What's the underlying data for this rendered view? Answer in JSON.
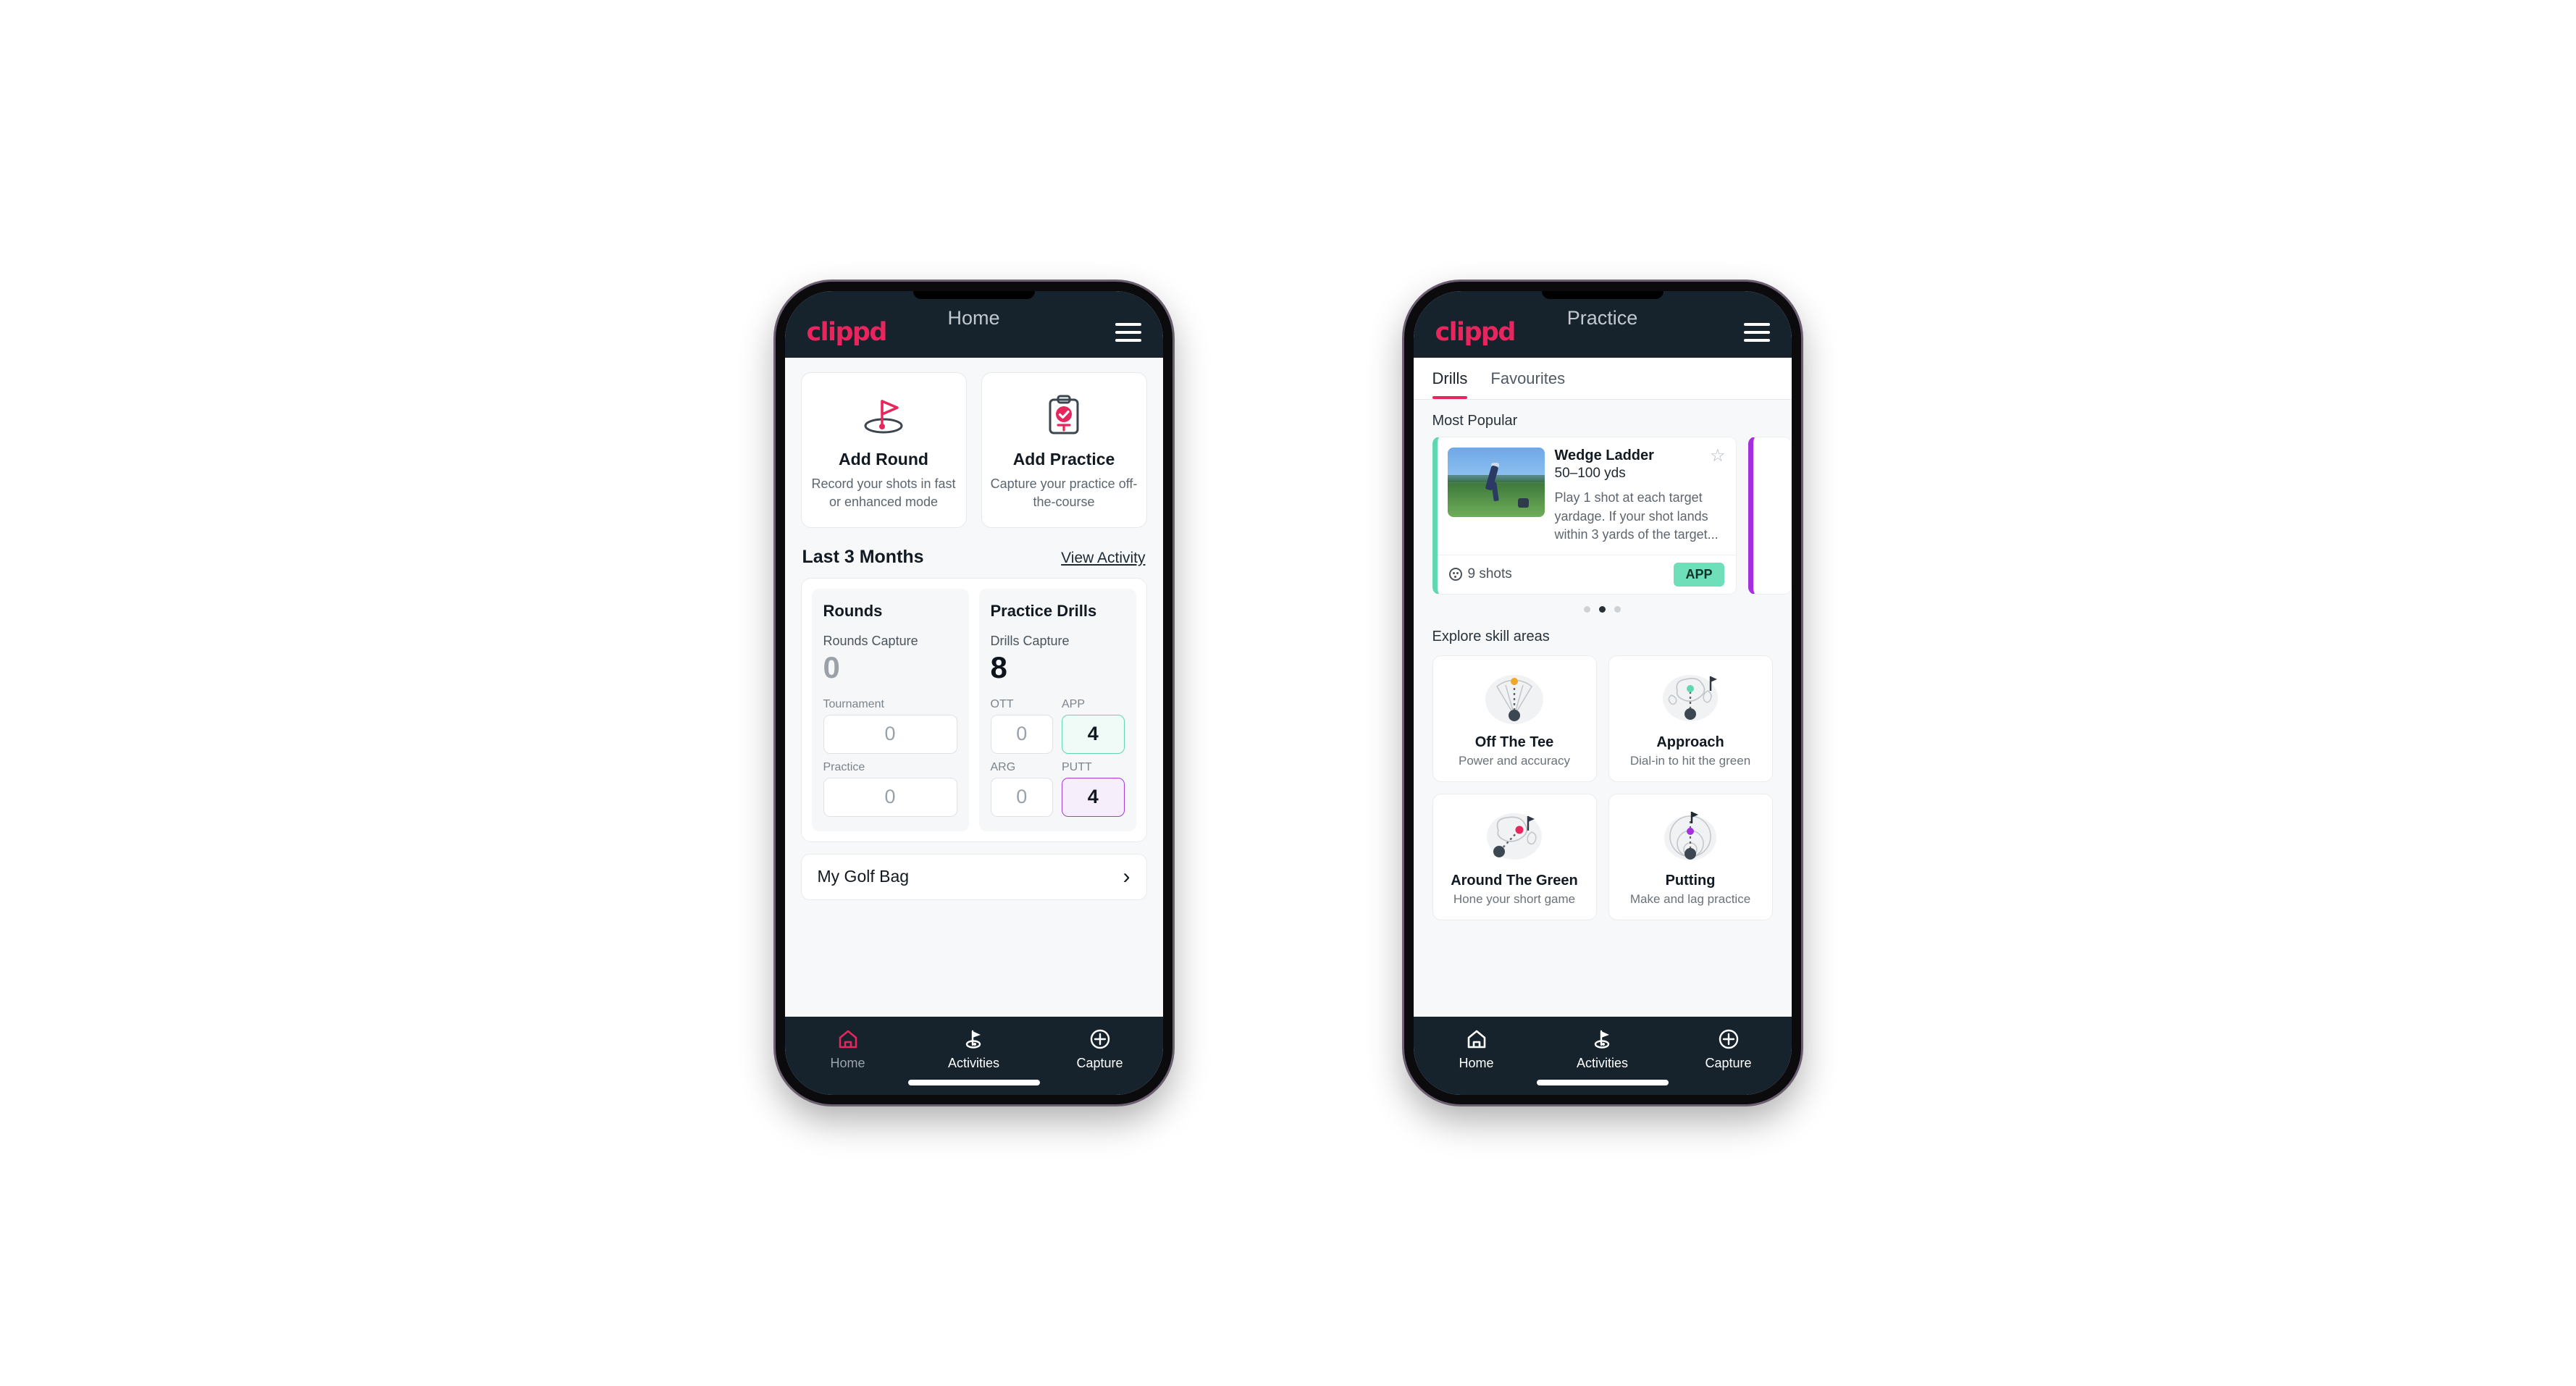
{
  "theme": {
    "brand_pink": "#e8265e",
    "appbar_dark": "#16222c",
    "accent_green": "#6fdfb9",
    "accent_purple": "#a52fe0",
    "page_bg": "#f7f8f9"
  },
  "phone_home": {
    "appbar": {
      "logo": "clippd",
      "title": "Home",
      "menu_icon": "hamburger-icon"
    },
    "quick_actions": [
      {
        "icon": "golf-flag-icon",
        "title": "Add Round",
        "subtitle": "Record your shots in fast or enhanced mode"
      },
      {
        "icon": "clipboard-check-icon",
        "title": "Add Practice",
        "subtitle": "Capture your practice off-the-course"
      }
    ],
    "section": {
      "title": "Last 3 Months",
      "link": "View Activity"
    },
    "rounds": {
      "title": "Rounds",
      "capture_label": "Rounds Capture",
      "capture_value": "0",
      "fields": [
        {
          "label": "Tournament",
          "value": "0",
          "highlight": "none"
        },
        {
          "label": "Practice",
          "value": "0",
          "highlight": "none"
        }
      ]
    },
    "drills": {
      "title": "Practice Drills",
      "capture_label": "Drills Capture",
      "capture_value": "8",
      "fields": [
        {
          "label": "OTT",
          "value": "0",
          "highlight": "none"
        },
        {
          "label": "APP",
          "value": "4",
          "highlight": "green"
        },
        {
          "label": "ARG",
          "value": "0",
          "highlight": "none"
        },
        {
          "label": "PUTT",
          "value": "4",
          "highlight": "purple"
        }
      ]
    },
    "golf_bag": {
      "label": "My Golf Bag",
      "chevron": "chevron-right-icon"
    },
    "bottom_nav": [
      {
        "icon": "home-icon",
        "label": "Home",
        "active": true
      },
      {
        "icon": "golf-flag-icon",
        "label": "Activities",
        "active": false
      },
      {
        "icon": "plus-circle-icon",
        "label": "Capture",
        "active": false
      }
    ]
  },
  "phone_practice": {
    "appbar": {
      "logo": "clippd",
      "title": "Practice",
      "menu_icon": "hamburger-icon"
    },
    "tabs": [
      {
        "label": "Drills",
        "active": true
      },
      {
        "label": "Favourites",
        "active": false
      }
    ],
    "most_popular_label": "Most Popular",
    "drill_card": {
      "thumbnail": "golfer-chipping-photo",
      "name": "Wedge Ladder",
      "yardage": "50–100 yds",
      "description": "Play 1 shot at each target yardage. If your shot lands within 3 yards of the target...",
      "favourite_icon": "star-outline-icon",
      "shots_icon": "golf-ball-icon",
      "shots_label": "9 shots",
      "badge": "APP",
      "accent": "#5fd7b1"
    },
    "next_card_accent": "#a52fe0",
    "carousel_dots": {
      "count": 3,
      "active_index": 1
    },
    "skill_areas_label": "Explore skill areas",
    "skill_areas": [
      {
        "icon": "tee-shot-dispersion-icon",
        "title": "Off The Tee",
        "subtitle": "Power and accuracy"
      },
      {
        "icon": "approach-green-icon",
        "title": "Approach",
        "subtitle": "Dial-in to hit the green"
      },
      {
        "icon": "chip-to-green-icon",
        "title": "Around The Green",
        "subtitle": "Hone your short game"
      },
      {
        "icon": "putting-rings-icon",
        "title": "Putting",
        "subtitle": "Make and lag practice"
      }
    ],
    "bottom_nav": [
      {
        "icon": "home-icon",
        "label": "Home",
        "active": false
      },
      {
        "icon": "golf-flag-icon",
        "label": "Activities",
        "active": true
      },
      {
        "icon": "plus-circle-icon",
        "label": "Capture",
        "active": false
      }
    ]
  }
}
